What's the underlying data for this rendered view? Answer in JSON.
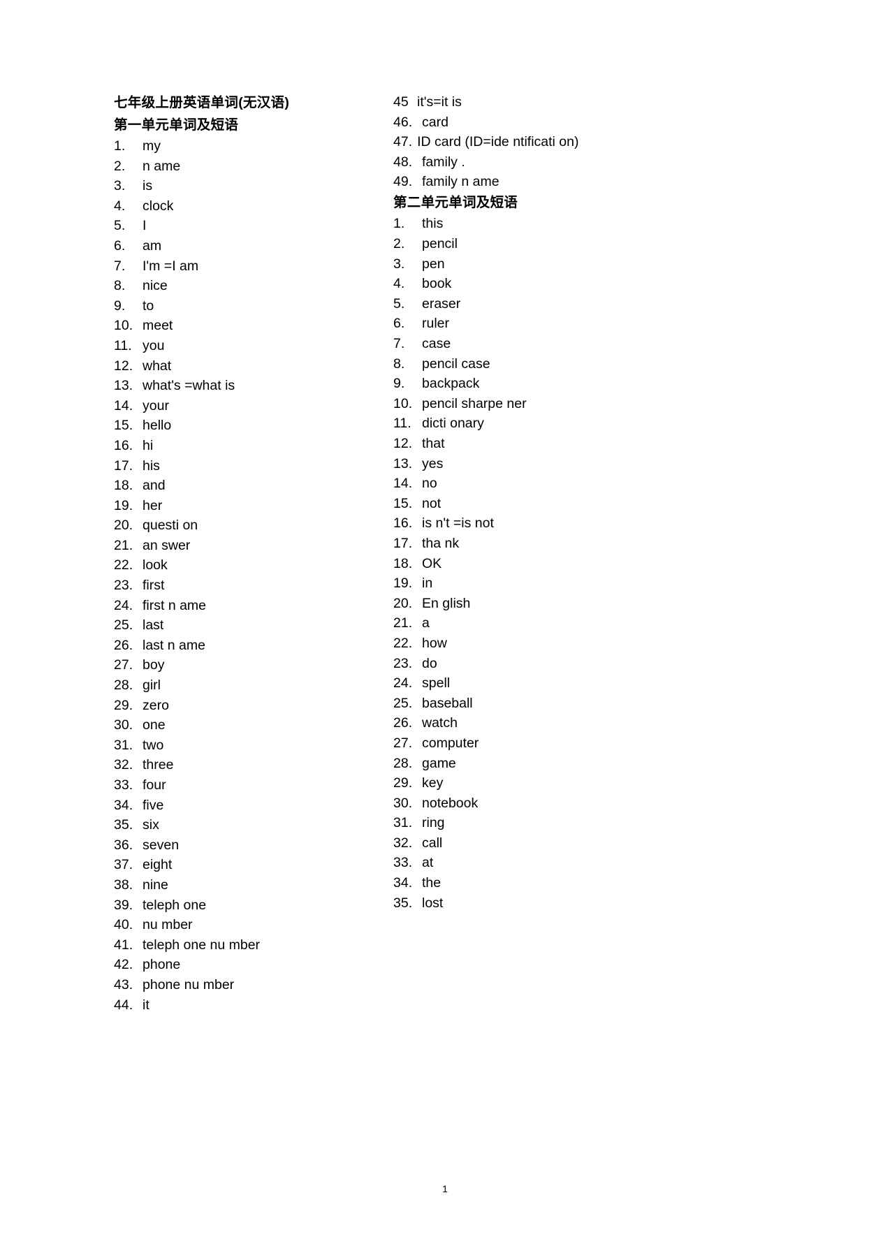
{
  "document": {
    "title": "七年级上册英语单词(无汉语)",
    "page_number": "1"
  },
  "columns": [
    {
      "heading": "第一单元单词及短语",
      "items": [
        {
          "num": "1.",
          "text": "my"
        },
        {
          "num": "2.",
          "text": "n ame"
        },
        {
          "num": "3.",
          "text": "is"
        },
        {
          "num": "4.",
          "text": "clock"
        },
        {
          "num": "5.",
          "text": "I"
        },
        {
          "num": "6.",
          "text": "am"
        },
        {
          "num": "7.",
          "text": "I'm =I am"
        },
        {
          "num": "8.",
          "text": "nice"
        },
        {
          "num": "9.",
          "text": "to"
        },
        {
          "num": "10.",
          "text": "meet"
        },
        {
          "num": "11.",
          "text": "you"
        },
        {
          "num": "12.",
          "text": "what"
        },
        {
          "num": "13.",
          "text": "what's =what is"
        },
        {
          "num": "14.",
          "text": "your"
        },
        {
          "num": "15.",
          "text": "hello"
        },
        {
          "num": "16.",
          "text": "hi"
        },
        {
          "num": "17.",
          "text": "his"
        },
        {
          "num": "18.",
          "text": "and"
        },
        {
          "num": "19.",
          "text": "her"
        },
        {
          "num": "20.",
          "text": "questi on"
        },
        {
          "num": "21.",
          "text": "an swer"
        },
        {
          "num": "22.",
          "text": "look"
        },
        {
          "num": "23.",
          "text": "first"
        },
        {
          "num": "24.",
          "text": "first n ame"
        },
        {
          "num": "25.",
          "text": "last"
        },
        {
          "num": "26.",
          "text": "last n ame"
        },
        {
          "num": "27.",
          "text": "boy"
        },
        {
          "num": "28.",
          "text": "girl"
        },
        {
          "num": "29.",
          "text": "zero"
        },
        {
          "num": "30.",
          "text": "one"
        },
        {
          "num": "31.",
          "text": "two"
        },
        {
          "num": "32.",
          "text": "three"
        },
        {
          "num": "33.",
          "text": "four"
        },
        {
          "num": "34.",
          "text": "five"
        },
        {
          "num": "35.",
          "text": "six"
        },
        {
          "num": "36.",
          "text": "seven"
        },
        {
          "num": "37.",
          "text": "eight"
        },
        {
          "num": "38.",
          "text": "nine"
        },
        {
          "num": "39.",
          "text": "teleph one"
        },
        {
          "num": "40.",
          "text": "nu mber"
        },
        {
          "num": "41.",
          "text": "teleph one nu mber"
        },
        {
          "num": "42.",
          "text": "phone"
        },
        {
          "num": "43.",
          "text": "phone nu mber"
        },
        {
          "num": "44.",
          "text": "it"
        }
      ]
    },
    {
      "pre_heading_items": [
        {
          "num": "45",
          "text": "it's=it is",
          "style": "nodot"
        },
        {
          "num": "46.",
          "text": "card"
        },
        {
          "num": "47.",
          "text": "ID card (ID=ide ntificati on)",
          "style": "wrap"
        },
        {
          "num": "48.",
          "text": "family ."
        },
        {
          "num": "49.",
          "text": "family n ame"
        }
      ],
      "heading": "第二单元单词及短语",
      "items": [
        {
          "num": "1.",
          "text": "this"
        },
        {
          "num": "2.",
          "text": "pencil"
        },
        {
          "num": "3.",
          "text": "pen"
        },
        {
          "num": "4.",
          "text": "book"
        },
        {
          "num": "5.",
          "text": "eraser"
        },
        {
          "num": "6.",
          "text": "ruler"
        },
        {
          "num": "7.",
          "text": "case"
        },
        {
          "num": "8.",
          "text": "pencil case"
        },
        {
          "num": "9.",
          "text": "backpack"
        },
        {
          "num": "10.",
          "text": "pencil sharpe ner"
        },
        {
          "num": "11.",
          "text": "dicti onary"
        },
        {
          "num": "12.",
          "text": "that"
        },
        {
          "num": "13.",
          "text": "yes"
        },
        {
          "num": "14.",
          "text": "no"
        },
        {
          "num": "15.",
          "text": "not"
        },
        {
          "num": "16.",
          "text": "is n't =is not"
        },
        {
          "num": "17.",
          "text": "tha nk"
        },
        {
          "num": "18.",
          "text": "OK"
        },
        {
          "num": "19.",
          "text": "in"
        },
        {
          "num": "20.",
          "text": "En glish"
        },
        {
          "num": "21.",
          "text": "a"
        },
        {
          "num": "22.",
          "text": "how"
        },
        {
          "num": "23.",
          "text": "do"
        },
        {
          "num": "24.",
          "text": "spell"
        },
        {
          "num": "25.",
          "text": "baseball"
        },
        {
          "num": "26.",
          "text": "watch"
        },
        {
          "num": "27.",
          "text": "computer"
        },
        {
          "num": "28.",
          "text": "game"
        },
        {
          "num": "29.",
          "text": "key"
        },
        {
          "num": "30.",
          "text": "notebook"
        },
        {
          "num": "31.",
          "text": "ring"
        },
        {
          "num": "32.",
          "text": "call"
        },
        {
          "num": "33.",
          "text": "at"
        },
        {
          "num": "34.",
          "text": "the"
        },
        {
          "num": "35.",
          "text": "lost"
        }
      ]
    }
  ]
}
